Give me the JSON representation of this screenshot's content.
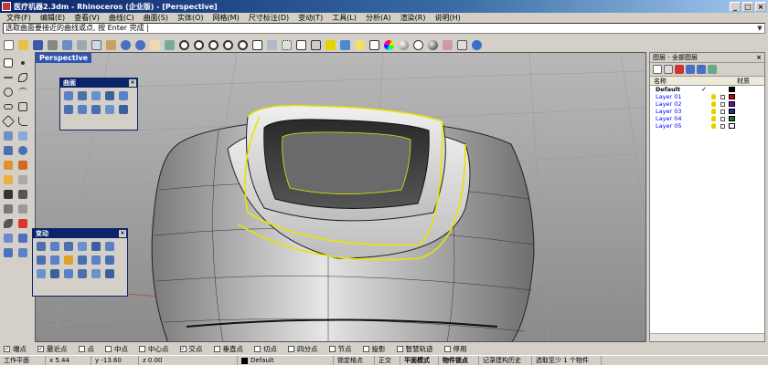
{
  "window": {
    "title": "医疗机器2.3dm - Rhinoceros (企业版) - [Perspective]"
  },
  "menu": [
    "文件(F)",
    "编辑(E)",
    "查看(V)",
    "曲线(C)",
    "曲面(S)",
    "实体(O)",
    "网格(M)",
    "尺寸标注(D)",
    "变动(T)",
    "工具(L)",
    "分析(A)",
    "渲染(R)",
    "说明(H)"
  ],
  "command": {
    "prompt": "选取曲面要接近的曲线或点, 按 Enter 完成 |"
  },
  "toolbar_icons": [
    "new-icon",
    "open-icon",
    "save-icon",
    "print-icon",
    "import-icon",
    "cut-icon",
    "copy-icon",
    "paste-icon",
    "undo-icon",
    "redo-icon",
    "pan-icon",
    "rotate-view-icon",
    "zoom-icon",
    "zoom-window-icon",
    "zoom-extents-icon",
    "zoom-selected-icon",
    "zoom-all-icon",
    "four-view-icon",
    "construction-plane-icon",
    "grid-icon",
    "show-object-icon",
    "hide-object-icon",
    "lock-icon",
    "layer-icon",
    "light-icon",
    "properties-icon",
    "color-wheel-icon",
    "sphere-shade-icon",
    "wireframe-icon",
    "render-icon",
    "material-icon",
    "options-icon",
    "help-icon"
  ],
  "left_tools": [
    "select-arrow-icon",
    "point-icon",
    "line-icon",
    "curve-icon",
    "circle-icon",
    "arc-icon",
    "ellipse-icon",
    "rectangle-icon",
    "polygon-icon",
    "curve-fillet-icon",
    "surface-icon",
    "extrude-icon",
    "solid-box-icon",
    "solid-sphere-icon",
    "mesh-icon",
    "boolean-icon",
    "transform-move-icon",
    "array-icon",
    "trim-icon",
    "split-icon",
    "join-icon",
    "explode-icon",
    "group-icon",
    "dimension-icon",
    "text-icon",
    "analyze-icon",
    "block-icon",
    "render-icon"
  ],
  "viewport": {
    "label": "Perspective"
  },
  "palette_surface": {
    "title": "曲面"
  },
  "palette_transform": {
    "title": "变动"
  },
  "layers": {
    "panel_title": "图层 - 全部图层",
    "col_name": "名称",
    "col_material": "材质",
    "rows": [
      {
        "name": "Default",
        "current": true,
        "color": "#000000"
      },
      {
        "name": "Layer 01",
        "current": false,
        "color": "#cc0000"
      },
      {
        "name": "Layer 02",
        "current": false,
        "color": "#6a0dad"
      },
      {
        "name": "Layer 03",
        "current": false,
        "color": "#1f2a9c"
      },
      {
        "name": "Layer 04",
        "current": false,
        "color": "#1a7a1a"
      },
      {
        "name": "Layer 05",
        "current": false,
        "color": "#ffffff"
      }
    ]
  },
  "osnap": [
    {
      "label": "端点",
      "checked": true
    },
    {
      "label": "最近点",
      "checked": true
    },
    {
      "label": "点",
      "checked": false
    },
    {
      "label": "中点",
      "checked": false
    },
    {
      "label": "中心点",
      "checked": false
    },
    {
      "label": "交点",
      "checked": true
    },
    {
      "label": "垂直点",
      "checked": false
    },
    {
      "label": "切点",
      "checked": false
    },
    {
      "label": "四分点",
      "checked": false
    },
    {
      "label": "节点",
      "checked": false
    },
    {
      "label": "投影",
      "checked": false
    },
    {
      "label": "智慧轨迹",
      "checked": false
    },
    {
      "label": "停用",
      "checked": false
    }
  ],
  "status": {
    "cplane": "工作平面",
    "x": "x 5.44",
    "y": "y -13.60",
    "z": "z 0.00",
    "layer": "Default",
    "snap": "锁定格点",
    "ortho": "正交",
    "planar": "平面模式",
    "osnap": "物件锁点",
    "history": "记录建构历史",
    "selection": "选取至少 1 个物件"
  },
  "colors": {
    "highlight": "#e6e600",
    "viewport_bg": "#a9a9a9",
    "titlebar": "#0a246a"
  }
}
